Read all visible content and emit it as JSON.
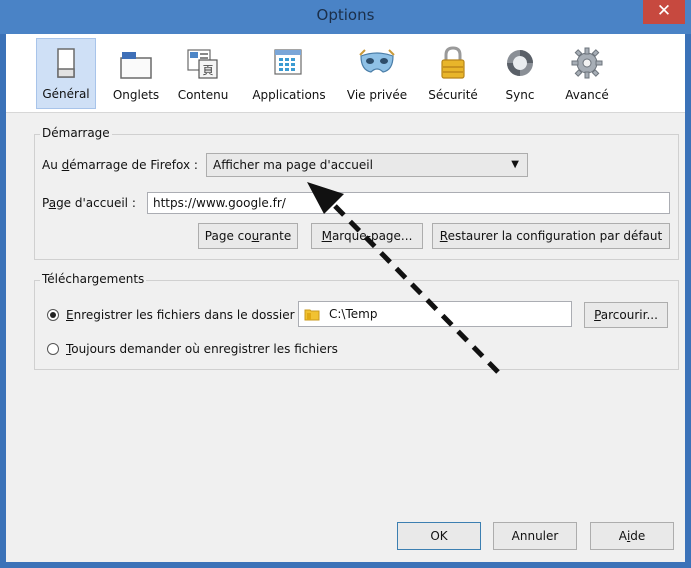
{
  "window": {
    "title": "Options",
    "close_symbol": "✕"
  },
  "tabs": [
    {
      "label": "Général",
      "icon": "general-icon",
      "active": true
    },
    {
      "label": "Onglets",
      "icon": "tabs-icon"
    },
    {
      "label": "Contenu",
      "icon": "content-icon"
    },
    {
      "label": "Applications",
      "icon": "applications-icon"
    },
    {
      "label": "Vie privée",
      "icon": "privacy-mask-icon"
    },
    {
      "label": "Sécurité",
      "icon": "padlock-icon"
    },
    {
      "label": "Sync",
      "icon": "sync-icon"
    },
    {
      "label": "Avancé",
      "icon": "gear-icon"
    }
  ],
  "startup": {
    "group_label": "Démarrage",
    "at_startup_pre": "Au ",
    "at_startup_key": "d",
    "at_startup_post": "émarrage de Firefox :",
    "startup_option": "Afficher ma page d'accueil",
    "homepage_pre": "P",
    "homepage_key": "a",
    "homepage_post": "ge d'accueil :",
    "homepage_value": "https://www.google.fr/",
    "btn_current_pre": "Page co",
    "btn_current_key": "u",
    "btn_current_post": "rante",
    "btn_bookmark_pre": "",
    "btn_bookmark_key": "M",
    "btn_bookmark_post": "arque-page...",
    "btn_restore_pre": "",
    "btn_restore_key": "R",
    "btn_restore_post": "estaurer la configuration par défaut"
  },
  "downloads": {
    "group_label": "Téléchargements",
    "save_pre": "",
    "save_key": "E",
    "save_post": "nregistrer les fichiers dans le dossier",
    "folder_path": "C:\\Temp",
    "browse_pre": "",
    "browse_key": "P",
    "browse_post": "arcourir...",
    "ask_pre": "",
    "ask_key": "T",
    "ask_post": "oujours demander où enregistrer les fichiers"
  },
  "footer": {
    "ok": "OK",
    "cancel": "Annuler",
    "help_pre": "A",
    "help_key": "i",
    "help_post": "de"
  },
  "colors": {
    "titlebar": "#4a83c6",
    "close": "#c7493f",
    "active_tab": "#cfe0f6"
  }
}
